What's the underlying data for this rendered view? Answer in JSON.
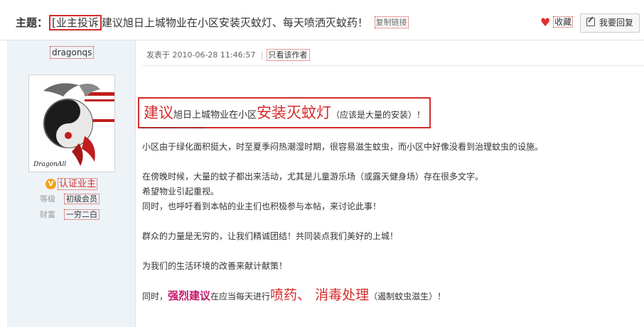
{
  "thread": {
    "label": "主题：",
    "tag": "[业主投诉",
    "title": "建议旭日上城物业在小区安装灭蚊灯、每天喷洒灭蚊药！",
    "copy_link": "复制链接",
    "favorite": "收藏",
    "reply": "我要回复"
  },
  "author": {
    "name": "dragonqs",
    "certification": "认证业主",
    "level_label": "等级",
    "level_value": "初级会员",
    "wealth_label": "财富",
    "wealth_value": "一穷二白",
    "avatar_signature": "DragonAll"
  },
  "post": {
    "posted_prefix": "发表于",
    "posted_time": "2010-06-28 11:46:57",
    "separator": "|",
    "only_author": "只看该作者",
    "headline": {
      "part1": "建议",
      "part2": "旭日上城物业在小区",
      "part3": "安装灭蚊灯",
      "part4": "（应该是大量的安装）！"
    },
    "paragraphs": [
      "小区由于绿化面积挺大，时至夏季闷热潮湿时期，很容易滋生蚊虫，而小区中好像没看到治理蚊虫的设施。",
      "在傍晚时候，大量的蚊子都出来活动，尤其是儿童游乐场（或露天健身场）存在很多文字。",
      "希望物业引起重视。",
      "同时，也呼吁看到本帖的业主们也积极参与本帖，来讨论此事！",
      "群众的力量是无穷的，让我们精诚团结！共同装点我们美好的上城！",
      "为我们的生活环境的改善来献计献策！"
    ],
    "last_line": {
      "part1": "同时，",
      "part2": "强烈建议",
      "part3": "在应当每天进行",
      "part4": "喷药、 消毒处理",
      "part5": "（遏制蚊虫滋生）！"
    }
  },
  "colors": {
    "accent_red": "#d62b2b",
    "magenta": "#c4186a",
    "sidebar_bg": "#eef3f7"
  },
  "icons": [
    "heart-icon",
    "edit-icon",
    "v-badge-icon"
  ]
}
